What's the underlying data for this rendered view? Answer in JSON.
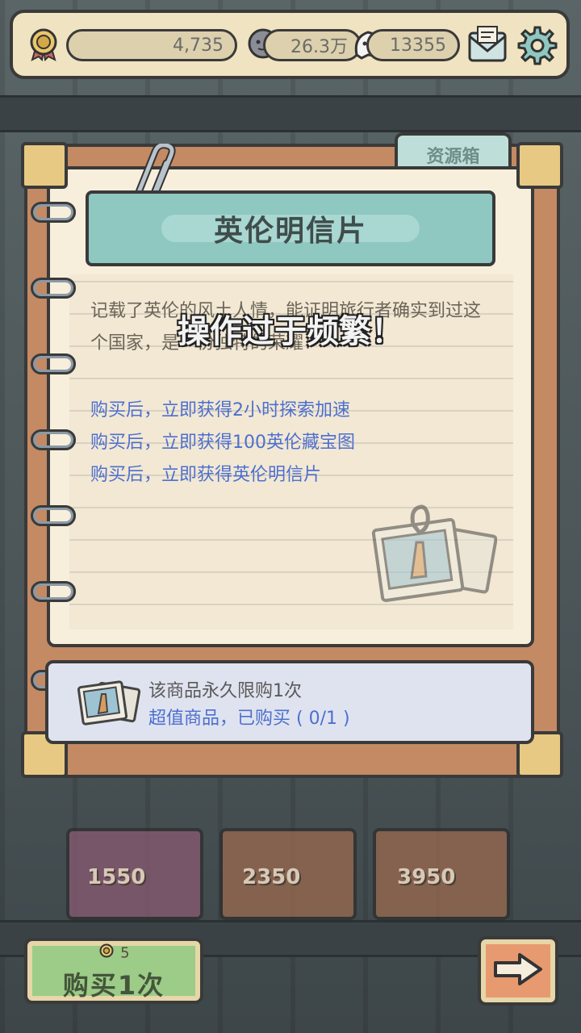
{
  "topbar": {
    "medals": "4,735",
    "bubbles": "26.3万",
    "souls": "13355"
  },
  "notebook": {
    "tab_label": "资源箱",
    "title": "英伦明信片",
    "description": "记载了英伦的风土人情，能证明旅行者确实到过这个国家，是一份独特的荣耀！",
    "bullets": [
      "购买后，立即获得2小时探索加速",
      "购买后，立即获得100英伦藏宝图",
      "购买后，立即获得英伦明信片"
    ],
    "limit_line1": "该商品永久限购1次",
    "limit_line2": "超值商品，已购买 ( 0/1 )"
  },
  "toast": "操作过于频繁！",
  "shelf": {
    "prices": [
      "1550",
      "2350",
      "3950"
    ]
  },
  "buy": {
    "cost": "5",
    "label": "购买1次"
  },
  "colors": {
    "banner": "#8fc7c1",
    "link_blue": "#4d6fd0",
    "buy_green": "#9ccc88",
    "next_orange": "#e79a6f"
  }
}
